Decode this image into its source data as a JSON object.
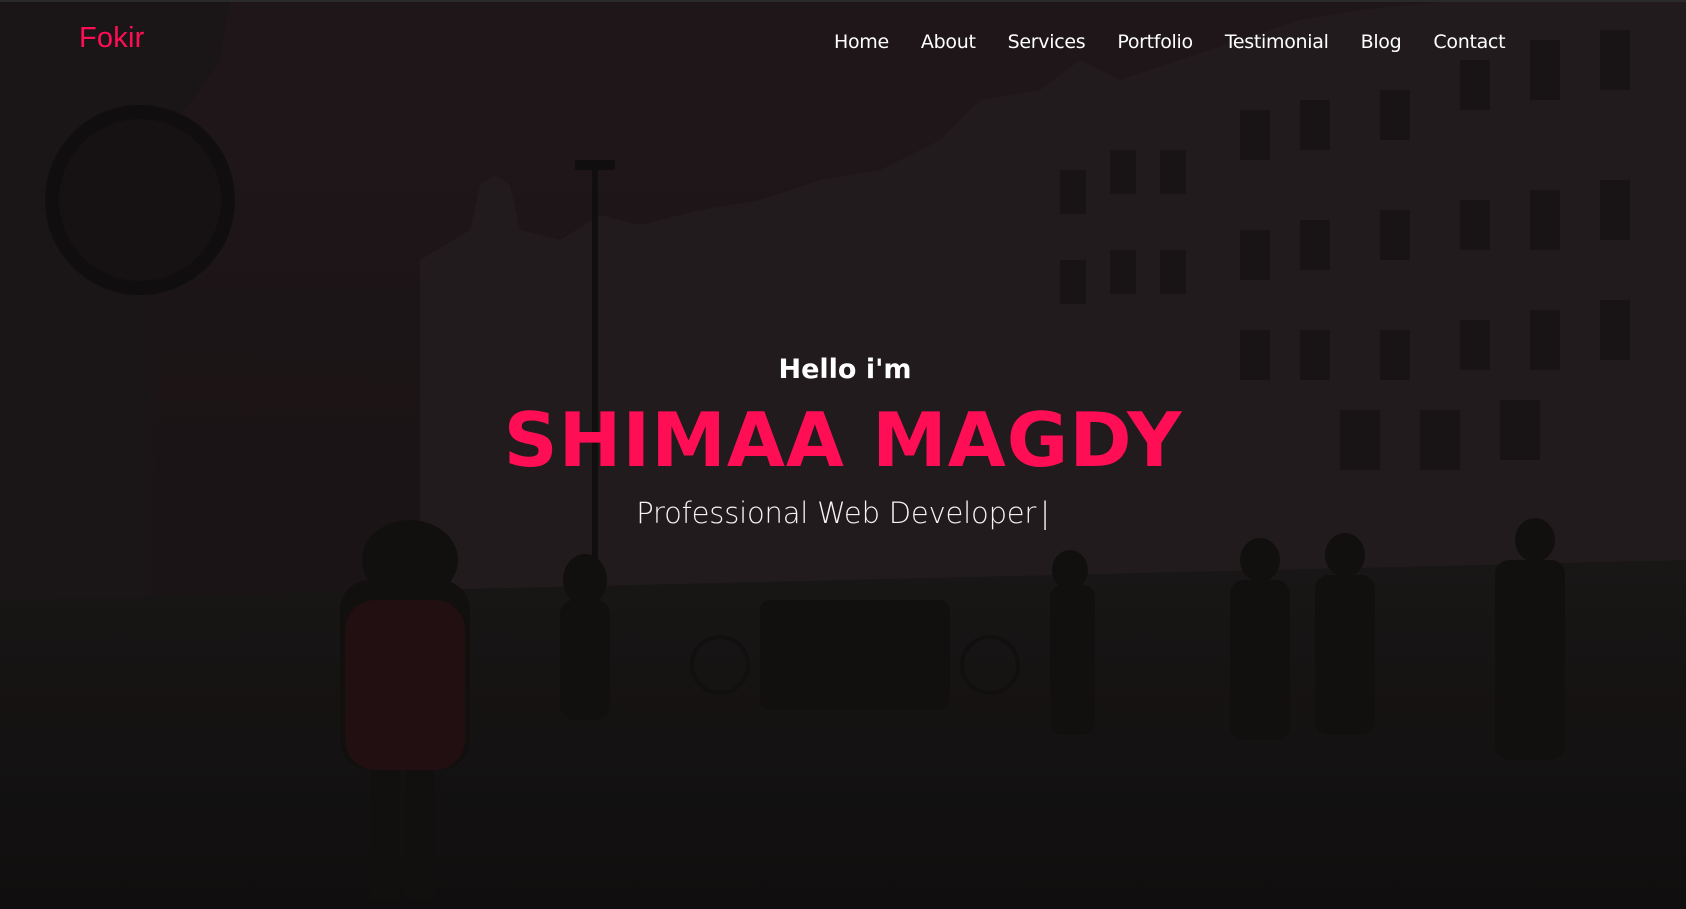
{
  "brand": {
    "logo_text": "Fokir",
    "accent_color": "#ff0e55"
  },
  "nav": {
    "items": [
      {
        "label": "Home"
      },
      {
        "label": "About"
      },
      {
        "label": "Services"
      },
      {
        "label": "Portfolio"
      },
      {
        "label": "Testimonial"
      },
      {
        "label": "Blog"
      },
      {
        "label": "Contact"
      }
    ]
  },
  "hero": {
    "greeting": "Hello i'm",
    "name": "SHIMAA MAGDY",
    "role": "Professional Web Developer",
    "cursor": "|",
    "background": "dark city street photo with pedestrians"
  }
}
